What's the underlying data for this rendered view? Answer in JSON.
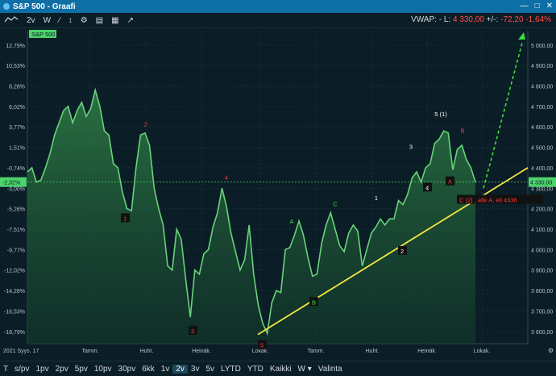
{
  "window": {
    "title": "S&P 500 - Graafi"
  },
  "toolbar": {
    "items": [
      "2v",
      "W"
    ],
    "vwap_label": "VWAP: -",
    "last_label": "L:",
    "last_value": "4 330,00",
    "change_label": "+/-:",
    "change_value": "-72,20",
    "change_pct": "-1,64%"
  },
  "chart_data": {
    "type": "line",
    "series_label": "S&P 500",
    "left_axis_ticks": [
      "12,79%",
      "10,53%",
      "8,28%",
      "6,02%",
      "3,77%",
      "1,51%",
      "-0,74%",
      "-3,00%",
      "-5,26%",
      "-7,51%",
      "-9,77%",
      "-12,02%",
      "-14,28%",
      "-16,53%",
      "-18,79%"
    ],
    "right_axis_ticks": [
      "5 000,00",
      "4 900,00",
      "4 800,00",
      "4 700,00",
      "4 600,00",
      "4 500,00",
      "4 400,00",
      "4 300,00",
      "4 200,00",
      "4 100,00",
      "4 000,00",
      "3 900,00",
      "3 800,00",
      "3 700,00",
      "3 600,00"
    ],
    "current_pct_label": "-2,32%",
    "current_price_label": "4 330,00",
    "x_labels": [
      "2021 Syys. 17",
      "Tamm.",
      "Huht.",
      "Heinäk.",
      "Lokak.",
      "Tamm.",
      "Huht.",
      "Heinäk.",
      "Lokak."
    ],
    "ylim": [
      3540,
      5070
    ],
    "values": [
      4380,
      4400,
      4330,
      4340,
      4400,
      4470,
      4560,
      4620,
      4680,
      4700,
      4620,
      4680,
      4720,
      4650,
      4690,
      4780,
      4700,
      4580,
      4560,
      4420,
      4400,
      4280,
      4200,
      4190,
      4400,
      4560,
      4570,
      4510,
      4300,
      4200,
      4120,
      3920,
      3900,
      4100,
      4050,
      3850,
      3670,
      3900,
      3880,
      3980,
      4000,
      4110,
      4180,
      4300,
      4210,
      4080,
      3990,
      3900,
      3950,
      4120,
      3880,
      3730,
      3640,
      3590,
      3740,
      3800,
      3790,
      4000,
      4010,
      4070,
      4140,
      4070,
      3960,
      3870,
      3880,
      4030,
      4120,
      4180,
      4100,
      4020,
      3990,
      4080,
      4120,
      4090,
      3920,
      4000,
      4080,
      4110,
      4150,
      4120,
      4150,
      4150,
      4240,
      4220,
      4270,
      4350,
      4380,
      4330,
      4400,
      4420,
      4520,
      4540,
      4580,
      4570,
      4390,
      4490,
      4510,
      4440,
      4400,
      4330
    ],
    "annotations": [
      {
        "label": "1",
        "color": "#ff3a3a",
        "boxed": true,
        "price": 4150
      },
      {
        "label": "2",
        "color": "#ff3a3a",
        "boxed": false,
        "price": 4610
      },
      {
        "label": "3",
        "color": "#ff3a3a",
        "boxed": true,
        "price": 3600
      },
      {
        "label": "4",
        "color": "#ff3a3a",
        "boxed": false,
        "price": 4350
      },
      {
        "label": "5",
        "color": "#ff3a3a",
        "boxed": true,
        "price": 3530
      },
      {
        "label": "A",
        "color": "#40e040",
        "boxed": false,
        "price": 4135
      },
      {
        "label": "B",
        "color": "#40e040",
        "boxed": true,
        "price": 3740
      },
      {
        "label": "C",
        "color": "#40e040",
        "boxed": false,
        "price": 4220
      },
      {
        "label": "1",
        "color": "#ffffff",
        "boxed": false,
        "price": 4250
      },
      {
        "label": "2",
        "color": "#ffffff",
        "boxed": true,
        "price": 3990
      },
      {
        "label": "3",
        "color": "#ffffff",
        "boxed": false,
        "price": 4500
      },
      {
        "label": "4",
        "color": "#ffffff",
        "boxed": true,
        "price": 4300
      },
      {
        "label": "5 (1)",
        "color": "#ffffff",
        "boxed": false,
        "price": 4660
      },
      {
        "label": "A",
        "color": "#ff3a3a",
        "boxed": true,
        "price": 4330
      },
      {
        "label": "B",
        "color": "#ff3a3a",
        "boxed": false,
        "price": 4580
      },
      {
        "label": "C (2) , alle A, eli 4336",
        "color": "#ff3a3a",
        "boxed": true,
        "price": 4240
      }
    ]
  },
  "range_buttons": [
    "T",
    "s/pv",
    "1pv",
    "2pv",
    "5pv",
    "10pv",
    "30pv",
    "6kk",
    "1v",
    "2v",
    "3v",
    "5v",
    "LYTD",
    "YTD",
    "Kaikki",
    "W",
    "Valinta"
  ],
  "active_range": "2v",
  "colors": {
    "line": "#69d37a",
    "fill": "#2e7a45",
    "accent": "#0e6fa7",
    "trend": "#f5e642",
    "projection": "#3ddc3d"
  }
}
